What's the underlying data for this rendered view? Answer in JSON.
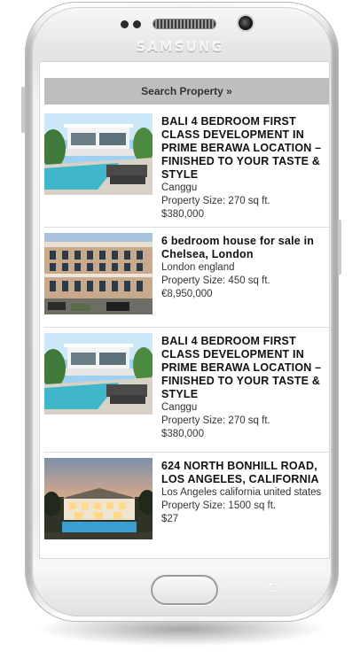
{
  "device": {
    "brand": "SAMSUNG"
  },
  "search": {
    "label": "Search Property »"
  },
  "listings": [
    {
      "title": "BALI 4 BEDROOM FIRST CLASS DEVELOPMENT IN PRIME BERAWA LOCATION – FINISHED TO YOUR TASTE & STYLE",
      "location": "Canggu",
      "size": "Property Size: 270 sq ft.",
      "price": "$380,000"
    },
    {
      "title": "6 bedroom house for sale in Chelsea, London",
      "location": "London england",
      "size": "Property Size: 450 sq ft.",
      "price": "€8,950,000"
    },
    {
      "title": "BALI 4 BEDROOM FIRST CLASS DEVELOPMENT IN PRIME BERAWA LOCATION – FINISHED TO YOUR TASTE & STYLE",
      "location": "Canggu",
      "size": "Property Size: 270 sq ft.",
      "price": "$380,000"
    },
    {
      "title": "624 NORTH BONHILL ROAD, LOS ANGELES, CALIFORNIA",
      "location": "Los Angeles california united states",
      "size": "Property Size: 1500 sq ft.",
      "price": "$27"
    }
  ],
  "colors": {
    "search_bar": "#bebebe",
    "pool": "#3fb6c9",
    "sky": "#8ec6e8"
  },
  "icons": {
    "recent_apps": "recent-apps-icon",
    "back": "back-icon",
    "home": "home-button"
  }
}
